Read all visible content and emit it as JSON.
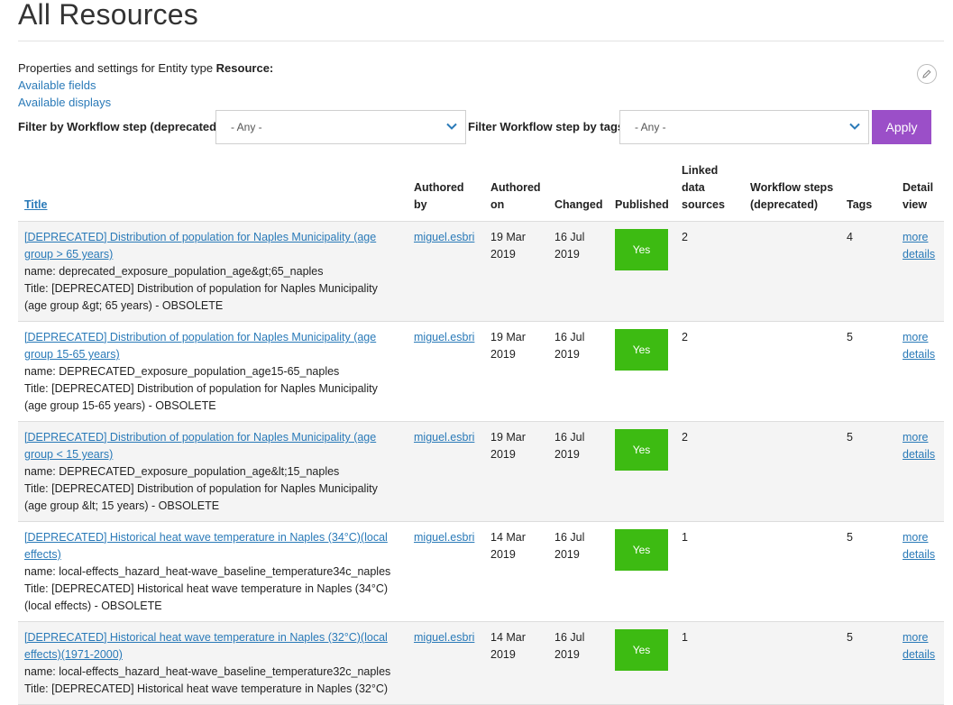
{
  "page": {
    "title": "All Resources"
  },
  "properties": {
    "intro_prefix": "Properties and settings for Entity type ",
    "intro_bold": "Resource:",
    "link_fields": "Available fields",
    "link_displays": "Available displays"
  },
  "edit_icon": "pencil-icon",
  "filters": {
    "workflow_label": "Filter by Workflow step (deprecated)",
    "workflow_value": "- Any -",
    "tags_label": "Filter Workflow step by tags",
    "tags_value": "- Any -",
    "apply_label": "Apply",
    "apply_color": "#9b4fc8"
  },
  "table": {
    "headers": {
      "title": "Title",
      "authored_by": "Authored by",
      "authored_on": "Authored on",
      "changed": "Changed",
      "published": "Published",
      "linked": "Linked data sources",
      "workflow": "Workflow steps (deprecated)",
      "tags": "Tags",
      "detail": "Detail view"
    },
    "rows": [
      {
        "title": "[DEPRECATED] Distribution of population for Naples Municipality (age group > 65 years)",
        "name": "name: deprecated_exposure_population_age&gt;65_naples",
        "full_title": "Title: [DEPRECATED] Distribution of population for Naples Municipality (age group &gt; 65 years) - OBSOLETE",
        "author": "miguel.esbri",
        "authored_on": "19 Mar 2019",
        "changed": "16 Jul 2019",
        "published": "Yes",
        "linked": "2",
        "workflow": "",
        "tags": "4",
        "detail": "more details"
      },
      {
        "title": "[DEPRECATED] Distribution of population for Naples Municipality (age group 15-65 years)",
        "name": "name: DEPRECATED_exposure_population_age15-65_naples",
        "full_title": "Title: [DEPRECATED] Distribution of population for Naples Municipality (age group 15-65 years) - OBSOLETE",
        "author": "miguel.esbri",
        "authored_on": "19 Mar 2019",
        "changed": "16 Jul 2019",
        "published": "Yes",
        "linked": "2",
        "workflow": "",
        "tags": "5",
        "detail": "more details"
      },
      {
        "title": "[DEPRECATED] Distribution of population for Naples Municipality (age group < 15 years)",
        "name": "name: DEPRECATED_exposure_population_age&lt;15_naples",
        "full_title": "Title: [DEPRECATED] Distribution of population for Naples Municipality (age group &lt; 15 years) - OBSOLETE",
        "author": "miguel.esbri",
        "authored_on": "19 Mar 2019",
        "changed": "16 Jul 2019",
        "published": "Yes",
        "linked": "2",
        "workflow": "",
        "tags": "5",
        "detail": "more details"
      },
      {
        "title": "[DEPRECATED] Historical heat wave temperature in Naples (34°C)(local effects)",
        "name": "name: local-effects_hazard_heat-wave_baseline_temperature34c_naples",
        "full_title": "Title: [DEPRECATED] Historical heat wave temperature in Naples (34°C) (local effects) - OBSOLETE",
        "author": "miguel.esbri",
        "authored_on": "14 Mar 2019",
        "changed": "16 Jul 2019",
        "published": "Yes",
        "linked": "1",
        "workflow": "",
        "tags": "5",
        "detail": "more details"
      },
      {
        "title": "[DEPRECATED] Historical heat wave temperature in Naples (32°C)(local effects)(1971-2000)",
        "name": "name: local-effects_hazard_heat-wave_baseline_temperature32c_naples",
        "full_title": "Title: [DEPRECATED] Historical heat wave temperature in Naples (32°C)",
        "author": "miguel.esbri",
        "authored_on": "14 Mar 2019",
        "changed": "16 Jul 2019",
        "published": "Yes",
        "linked": "1",
        "workflow": "",
        "tags": "5",
        "detail": "more details"
      }
    ]
  },
  "colors": {
    "link": "#2a7ab8",
    "published_badge": "#3dbb12",
    "row_stripe": "#f4f4f4"
  }
}
